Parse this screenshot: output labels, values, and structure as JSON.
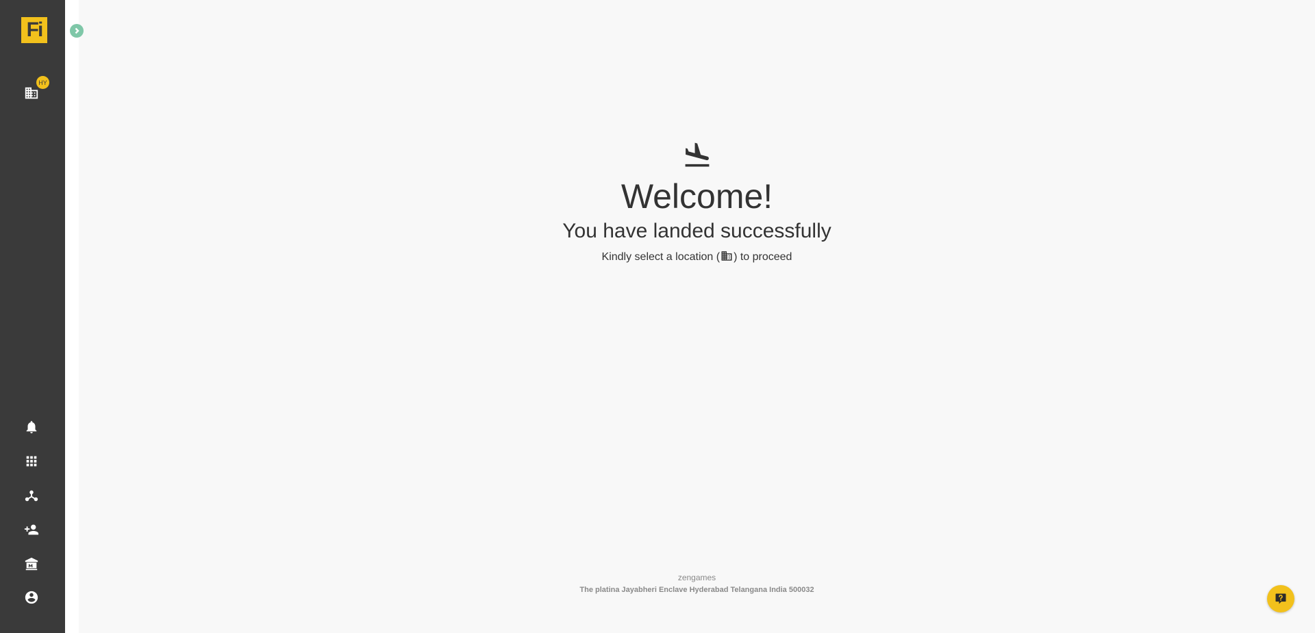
{
  "sidebar": {
    "logo_text": "Fi",
    "location_badge": "HY",
    "top_icons": [
      "building-icon"
    ],
    "bottom_icons": [
      "bell-icon",
      "apps-grid-icon",
      "network-icon",
      "add-user-icon",
      "bank-icon",
      "account-circle-icon"
    ]
  },
  "main": {
    "icon": "flight-land-icon",
    "title": "Welcome!",
    "subtitle": "You have landed successfully",
    "instruction_prefix": "Kindly select a location (",
    "instruction_suffix": ") to proceed"
  },
  "footer": {
    "company": "zengames",
    "address": "The platina Jayabheri Enclave Hyderabad Telangana India 500032"
  },
  "help": {
    "icon": "help-chat-icon"
  },
  "colors": {
    "sidebar_bg": "#3a3a3a",
    "accent": "#f2c11c",
    "expand_button": "#7fc7a8",
    "page_bg": "#f8f8f8"
  }
}
